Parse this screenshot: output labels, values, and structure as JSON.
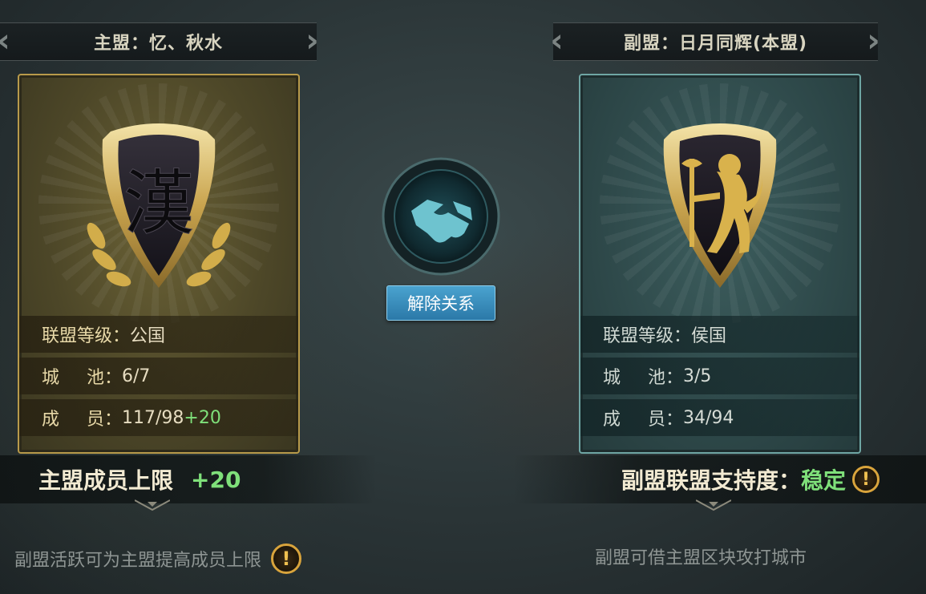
{
  "main_alliance": {
    "banner": "主盟：忆、秋水",
    "emblem_glyph": "漢",
    "stats": [
      {
        "key": "联盟等级：",
        "value": "公国",
        "bonus": ""
      },
      {
        "key_a": "城",
        "key_b": "池：",
        "value": "6/7",
        "bonus": ""
      },
      {
        "key_a": "成",
        "key_b": "员：",
        "value": "117/98",
        "bonus": "+20"
      }
    ],
    "info_label": "主盟成员上限",
    "info_bonus": "+20",
    "footnote": "副盟活跃可为主盟提高成员上限"
  },
  "sub_alliance": {
    "banner": "副盟：日月同辉(本盟)",
    "emblem": "lion-crest",
    "stats": [
      {
        "key": "联盟等级：",
        "value": "侯国"
      },
      {
        "key_a": "城",
        "key_b": "池：",
        "value": "3/5"
      },
      {
        "key_a": "成",
        "key_b": "员：",
        "value": "34/94"
      }
    ],
    "info_label": "副盟联盟支持度：",
    "info_status": "稳定",
    "footnote": "副盟可借主盟区块攻打城市"
  },
  "center": {
    "icon": "handshake-icon",
    "dissolve_button": "解除关系"
  },
  "warn_glyph": "!",
  "colors": {
    "gold": "#b89a4a",
    "teal": "#6fa6a4",
    "green": "#7fe07a",
    "button": "#2b79a8"
  }
}
